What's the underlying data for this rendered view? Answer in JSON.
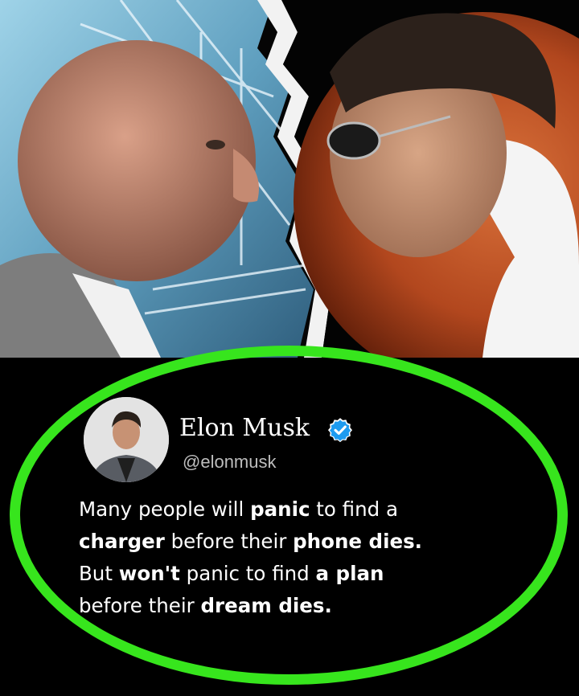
{
  "tweet": {
    "author_name": "Elon Musk",
    "handle": "@elonmusk",
    "verified_icon": "verified-badge-icon",
    "lines": [
      [
        {
          "t": "Many people will ",
          "b": false
        },
        {
          "t": "panic",
          "b": true
        },
        {
          "t": " to find a",
          "b": false
        }
      ],
      [
        {
          "t": "charger",
          "b": true
        },
        {
          "t": " before their ",
          "b": false
        },
        {
          "t": "phone dies.",
          "b": true
        }
      ],
      [
        {
          "t": "But ",
          "b": false
        },
        {
          "t": "won't",
          "b": true
        },
        {
          "t": " panic to find ",
          "b": false
        },
        {
          "t": "a plan",
          "b": true
        }
      ],
      [
        {
          "t": "before their ",
          "b": false
        },
        {
          "t": "dream dies.",
          "b": true
        }
      ]
    ]
  },
  "colors": {
    "highlight_ring": "#37e51d",
    "verified_blue": "#1d9bf0",
    "background": "#000000"
  }
}
